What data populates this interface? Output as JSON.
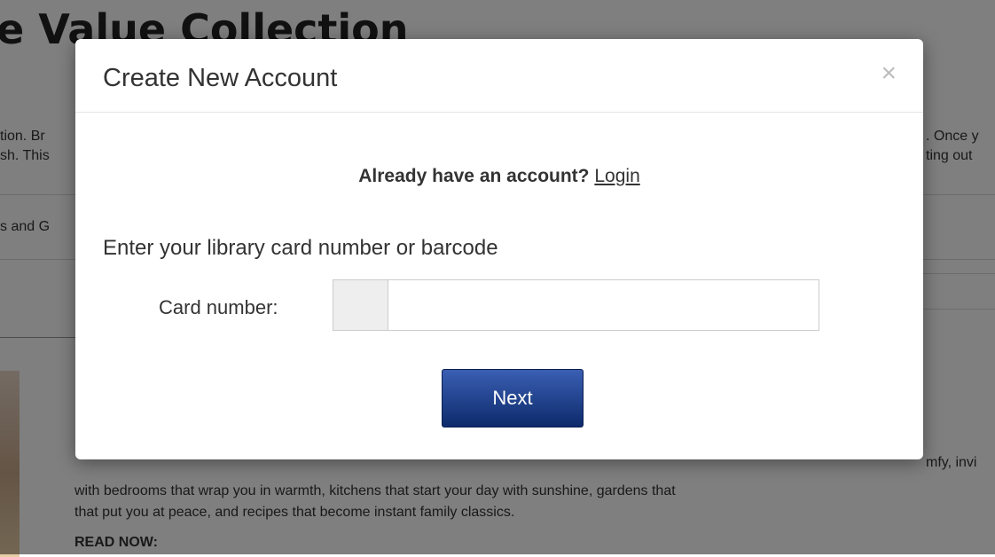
{
  "background": {
    "title": "e Value Collection",
    "lines_left": [
      "tion. Br",
      "sh. This",
      "s and G"
    ],
    "lines_right": [
      ". Once y",
      "ting out"
    ],
    "desc_right": "mfy, invi",
    "desc_line1": "with bedrooms that wrap you in warmth, kitchens that start your day with sunshine, gardens that",
    "desc_line2": "that put you at peace, and recipes that become instant family classics.",
    "read_now": "READ NOW:"
  },
  "modal": {
    "title": "Create New Account",
    "close_symbol": "×",
    "already_text": "Already have an account?",
    "login_link": "Login",
    "instructions": "Enter your library card number or barcode",
    "card_label": "Card number:",
    "card_value": "",
    "next_label": "Next"
  }
}
